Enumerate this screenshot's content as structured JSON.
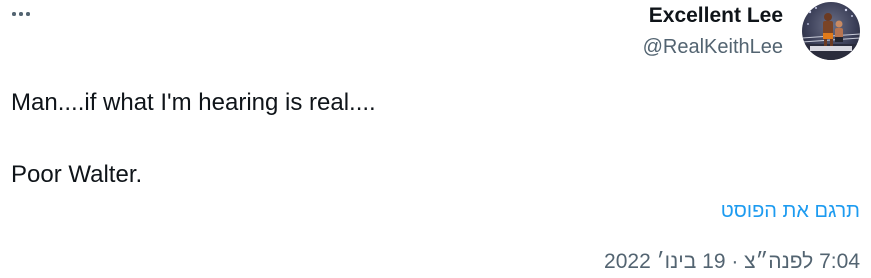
{
  "tweet": {
    "author": {
      "display_name": "Excellent Lee",
      "handle": "@RealKeithLee",
      "avatar_icon": "wrestling-ring-photo"
    },
    "more_icon": "more-horizontal-icon",
    "text_lines": [
      "Man....if what I'm hearing is real....",
      "Poor Walter."
    ],
    "translate_label": "תרגם את הפוסט",
    "timestamp": "7:04 לפנה״צ · 19 בינו׳ 2022"
  },
  "colors": {
    "text_primary": "#0f1419",
    "text_secondary": "#536471",
    "link": "#1d9bf0"
  }
}
